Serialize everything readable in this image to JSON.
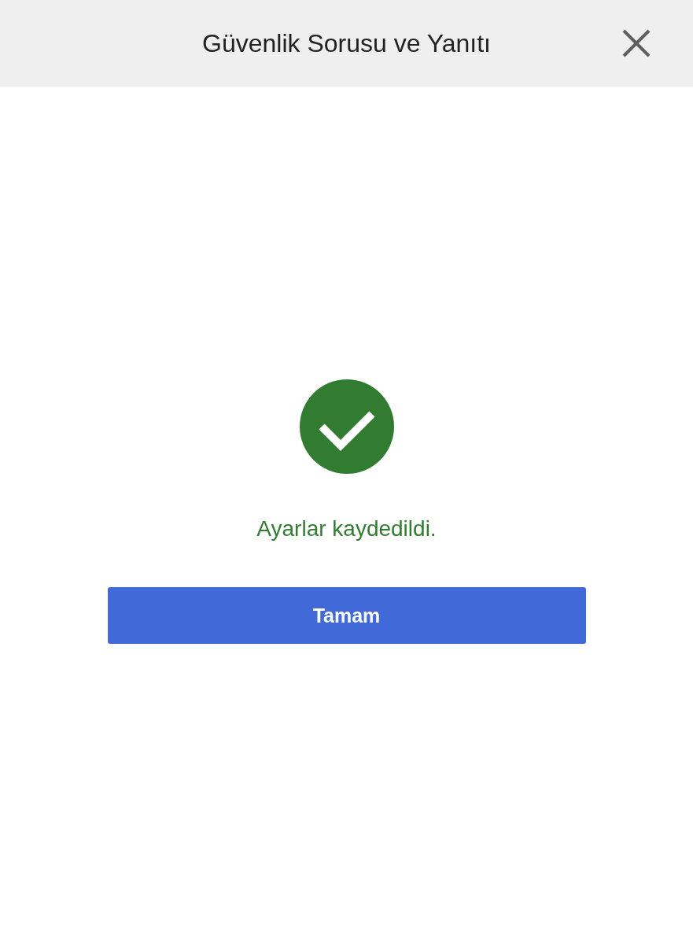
{
  "dialog": {
    "title": "Güvenlik Sorusu ve Yanıtı"
  },
  "message": {
    "kind": "success",
    "text": "Ayarlar kaydedildi."
  },
  "buttons": [
    {
      "label": "Tamam"
    }
  ]
}
